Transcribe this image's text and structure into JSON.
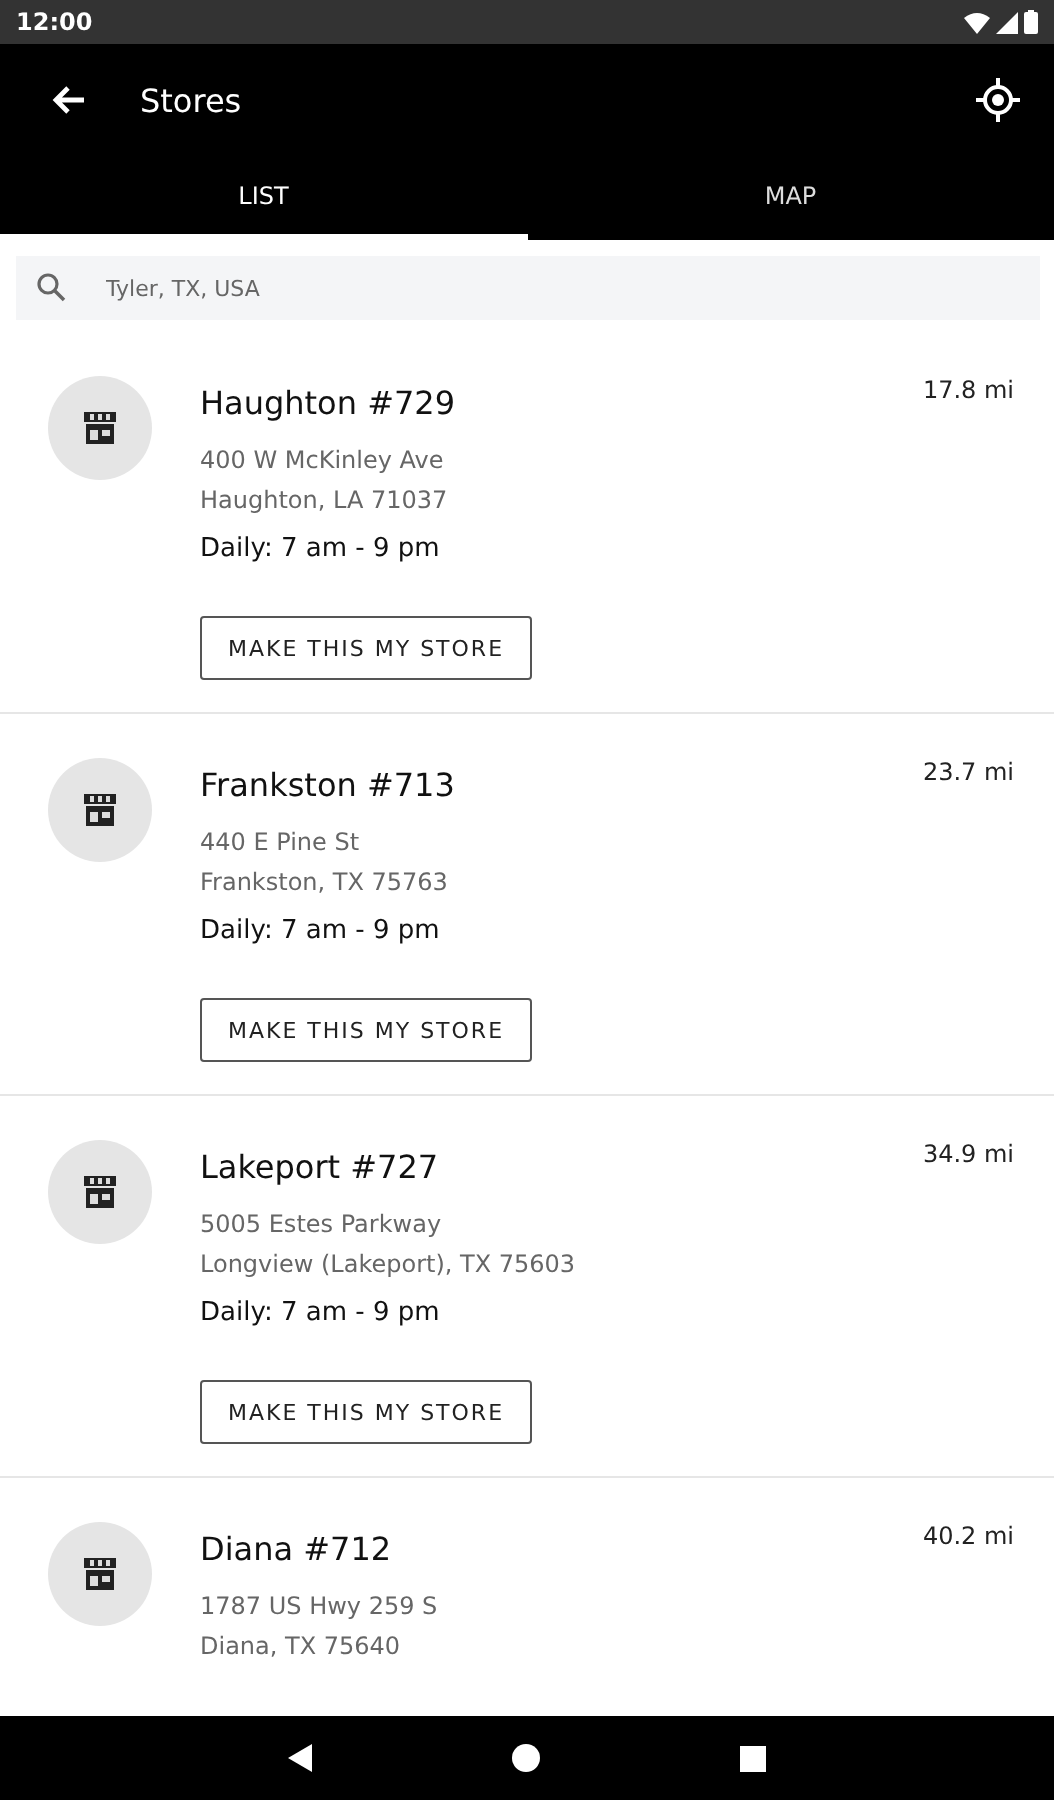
{
  "status_bar": {
    "time": "12:00"
  },
  "app_bar": {
    "title": "Stores"
  },
  "tabs": [
    {
      "label": "LIST",
      "selected": true
    },
    {
      "label": "MAP",
      "selected": false
    }
  ],
  "search": {
    "placeholder": "Tyler, TX, USA"
  },
  "stores": [
    {
      "name": "Haughton #729",
      "address_line_1": "400 W McKinley Ave",
      "address_line_2": "Haughton, LA 71037",
      "hours": "Daily: 7 am - 9 pm",
      "distance": "17.8 mi",
      "button": "MAKE THIS MY STORE"
    },
    {
      "name": "Frankston #713",
      "address_line_1": "440 E Pine St",
      "address_line_2": "Frankston, TX 75763",
      "hours": "Daily: 7 am - 9 pm",
      "distance": "23.7 mi",
      "button": "MAKE THIS MY STORE"
    },
    {
      "name": "Lakeport #727",
      "address_line_1": "5005 Estes Parkway",
      "address_line_2": "Longview (Lakeport), TX 75603",
      "hours": "Daily: 7 am - 9 pm",
      "distance": "34.9 mi",
      "button": "MAKE THIS MY STORE"
    },
    {
      "name": "Diana #712",
      "address_line_1": "1787 US Hwy 259 S",
      "address_line_2": "Diana, TX 75640",
      "distance": "40.2 mi"
    }
  ]
}
